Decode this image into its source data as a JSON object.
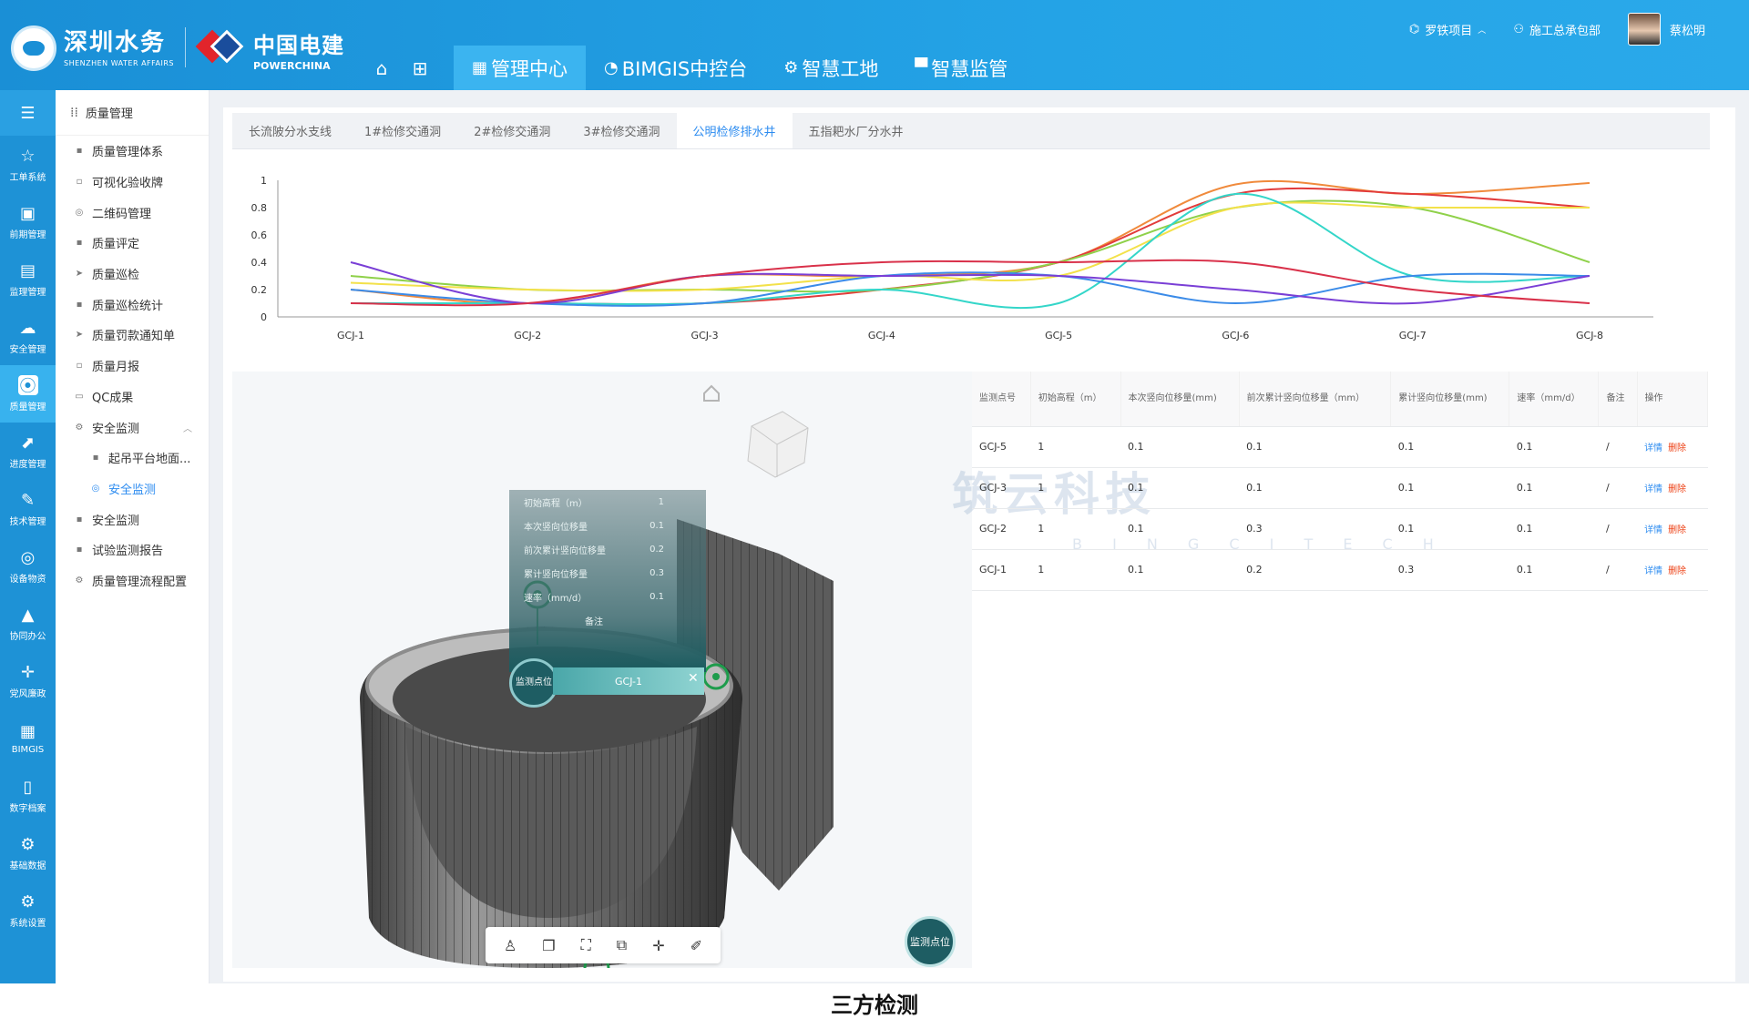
{
  "header": {
    "brand1_cn": "深圳水务",
    "brand1_en": "SHENZHEN WATER AFFAIRS",
    "brand2_cn": "中国电建",
    "brand2_en": "POWERCHINA",
    "nav": [
      {
        "label": "管理中心",
        "icon": "grid-icon"
      },
      {
        "label": "BIMGIS中控台",
        "icon": "dashboard-icon"
      },
      {
        "label": "智慧工地",
        "icon": "chip-icon"
      },
      {
        "label": "智慧监管",
        "icon": "monitor-icon"
      }
    ],
    "project": "罗铁项目",
    "department": "施工总承包部",
    "username": "蔡松明"
  },
  "rail": [
    {
      "label": "工单系统",
      "icon": "☆"
    },
    {
      "label": "前期管理",
      "icon": "▣"
    },
    {
      "label": "监理管理",
      "icon": "▤"
    },
    {
      "label": "安全管理",
      "icon": "☁"
    },
    {
      "label": "质量管理",
      "icon": "⦿"
    },
    {
      "label": "进度管理",
      "icon": "⬈"
    },
    {
      "label": "技术管理",
      "icon": "✎"
    },
    {
      "label": "设备物资",
      "icon": "◎"
    },
    {
      "label": "协同办公",
      "icon": "▲"
    },
    {
      "label": "党风廉政",
      "icon": "✛"
    },
    {
      "label": "BIMGIS",
      "icon": "▦"
    },
    {
      "label": "数字档案",
      "icon": "▯"
    },
    {
      "label": "基础数据",
      "icon": "⚙"
    },
    {
      "label": "系统设置",
      "icon": "⚙"
    }
  ],
  "side2": {
    "title": "质量管理",
    "items": [
      {
        "label": "质量管理体系",
        "icon": "▪"
      },
      {
        "label": "可视化验收牌",
        "icon": "▫"
      },
      {
        "label": "二维码管理",
        "icon": "◎"
      },
      {
        "label": "质量评定",
        "icon": "▪"
      },
      {
        "label": "质量巡检",
        "icon": "➤"
      },
      {
        "label": "质量巡检统计",
        "icon": "▪"
      },
      {
        "label": "质量罚款通知单",
        "icon": "➤"
      },
      {
        "label": "质量月报",
        "icon": "▫"
      },
      {
        "label": "QC成果",
        "icon": "▭"
      },
      {
        "label": "安全监测",
        "icon": "⚙"
      },
      {
        "label": "起吊平台地面...",
        "icon": "▪"
      },
      {
        "label": "安全监测",
        "icon": "◎"
      },
      {
        "label": "安全监测",
        "icon": "▪"
      },
      {
        "label": "试验监测报告",
        "icon": "▪"
      },
      {
        "label": "质量管理流程配置",
        "icon": "⚙"
      }
    ]
  },
  "tabs": [
    "长流陂分水支线",
    "1#检修交通洞",
    "2#检修交通洞",
    "3#检修交通洞",
    "公明检修排水井",
    "五指耙水厂分水井"
  ],
  "chart_data": {
    "type": "line",
    "categories": [
      "GCJ-1",
      "GCJ-2",
      "GCJ-3",
      "GCJ-4",
      "GCJ-5",
      "GCJ-6",
      "GCJ-7",
      "GCJ-8"
    ],
    "ylim": [
      0,
      1
    ],
    "yticks": [
      "0",
      "0.2",
      "0.4",
      "0.6",
      "0.8",
      "1"
    ],
    "series": [
      {
        "color": "#f08a3c",
        "values": [
          0.2,
          0.1,
          0.3,
          0.3,
          0.4,
          0.97,
          0.9,
          0.98
        ]
      },
      {
        "color": "#e23b3b",
        "values": [
          0.1,
          0.1,
          0.1,
          0.2,
          0.4,
          0.9,
          0.9,
          0.8
        ]
      },
      {
        "color": "#8fd14a",
        "values": [
          0.3,
          0.2,
          0.2,
          0.2,
          0.4,
          0.8,
          0.8,
          0.4
        ]
      },
      {
        "color": "#f3e14a",
        "values": [
          0.25,
          0.2,
          0.2,
          0.3,
          0.3,
          0.8,
          0.8,
          0.8
        ]
      },
      {
        "color": "#34d6c9",
        "values": [
          0.1,
          0.1,
          0.1,
          0.2,
          0.1,
          0.9,
          0.3,
          0.3
        ]
      },
      {
        "color": "#3b8be8",
        "values": [
          0.2,
          0.1,
          0.1,
          0.3,
          0.3,
          0.1,
          0.3,
          0.3
        ]
      },
      {
        "color": "#7a3fd6",
        "values": [
          0.4,
          0.1,
          0.3,
          0.3,
          0.3,
          0.2,
          0.1,
          0.3
        ]
      },
      {
        "color": "#d9314a",
        "values": [
          0.1,
          0.1,
          0.3,
          0.4,
          0.4,
          0.4,
          0.2,
          0.1
        ]
      }
    ]
  },
  "popup": {
    "rows": [
      {
        "k": "初始高程（m）",
        "v": "1"
      },
      {
        "k": "本次竖向位移量",
        "v": "0.1"
      },
      {
        "k": "前次累计竖向位移量",
        "v": "0.2"
      },
      {
        "k": "累计竖向位移量",
        "v": "0.3"
      },
      {
        "k": "速率（mm/d）",
        "v": "0.1"
      }
    ],
    "note_label": "备注",
    "tag_label": "监测点位",
    "point": "GCJ-1",
    "bubble2": "监测点位"
  },
  "watermark": "筑云科技",
  "watermark_en": "B I N G C I T E C H",
  "table": {
    "headers": [
      "监测点号",
      "初始高程（m）",
      "本次竖向位移量(mm)",
      "前次累计竖向位移量（mm）",
      "累计竖向位移量(mm)",
      "速率（mm/d）",
      "备注",
      "操作"
    ],
    "rows": [
      [
        "GCJ-5",
        "1",
        "0.1",
        "0.1",
        "0.1",
        "0.1",
        "/"
      ],
      [
        "GCJ-3",
        "1",
        "0.1",
        "0.1",
        "0.1",
        "0.1",
        "/"
      ],
      [
        "GCJ-2",
        "1",
        "0.1",
        "0.3",
        "0.1",
        "0.1",
        "/"
      ],
      [
        "GCJ-1",
        "1",
        "0.1",
        "0.2",
        "0.3",
        "0.1",
        "/"
      ]
    ],
    "detail_label": "详情",
    "delete_label": "删除"
  },
  "caption": "三方检测"
}
